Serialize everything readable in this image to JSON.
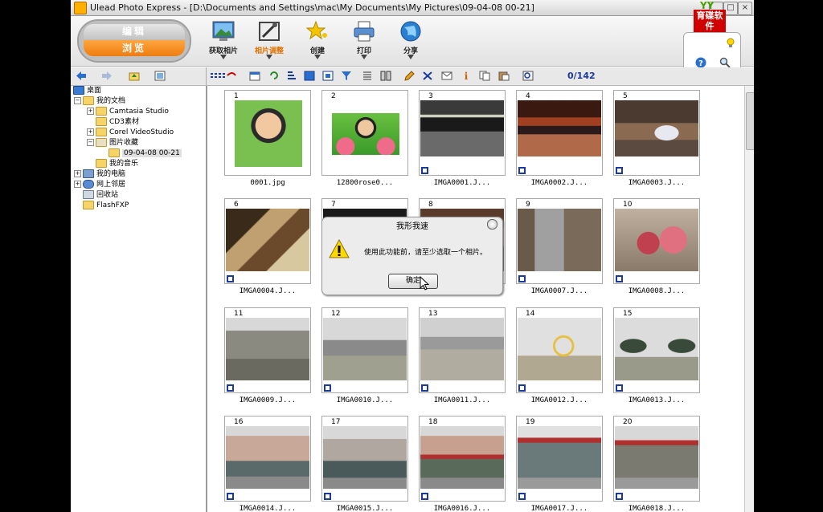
{
  "window": {
    "title": "Ulead Photo Express - [D:\\Documents and Settings\\mac\\My Documents\\My Pictures\\09-04-08 00-21]",
    "controls": {
      "minimize": "_",
      "maximize": "□",
      "close": "×"
    }
  },
  "logo": {
    "brand": "YY",
    "text": "育碟软件"
  },
  "modes": {
    "edit": "编辑",
    "browse": "浏览"
  },
  "toolbar": [
    {
      "label": "获取相片",
      "icon": "get-photo-icon"
    },
    {
      "label": "相片调整",
      "icon": "photo-adjust-icon"
    },
    {
      "label": "创建",
      "icon": "create-star-icon"
    },
    {
      "label": "打印",
      "icon": "printer-icon"
    },
    {
      "label": "分享",
      "icon": "share-globe-icon"
    }
  ],
  "browser": {
    "counter": "0/142"
  },
  "tree": [
    {
      "label": "桌面",
      "icon": "desktop-icon"
    },
    {
      "label": "我的文档",
      "icon": "documents-icon"
    },
    {
      "label": "Camtasia Studio",
      "icon": "folder-icon"
    },
    {
      "label": "CD3素材",
      "icon": "folder-icon"
    },
    {
      "label": "Corel VideoStudio",
      "icon": "folder-icon"
    },
    {
      "label": "图片收藏",
      "icon": "pictures-folder-icon"
    },
    {
      "label": "09-04-08 00-21",
      "icon": "folder-icon"
    },
    {
      "label": "我的音乐",
      "icon": "music-folder-icon"
    },
    {
      "label": "我的电脑",
      "icon": "computer-icon"
    },
    {
      "label": "网上邻居",
      "icon": "network-icon"
    },
    {
      "label": "回收站",
      "icon": "recycle-bin-icon"
    },
    {
      "label": "FlashFXP",
      "icon": "folder-icon"
    }
  ],
  "photos": [
    {
      "num": "1",
      "name": "0001.jpg"
    },
    {
      "num": "2",
      "name": "12800rose0..."
    },
    {
      "num": "3",
      "name": "IMGA0001.J..."
    },
    {
      "num": "4",
      "name": "IMGA0002.J..."
    },
    {
      "num": "5",
      "name": "IMGA0003.J..."
    },
    {
      "num": "6",
      "name": "IMGA0004.J..."
    },
    {
      "num": "7",
      "name": ""
    },
    {
      "num": "8",
      "name": ""
    },
    {
      "num": "9",
      "name": "IMGA0007.J..."
    },
    {
      "num": "10",
      "name": "IMGA0008.J..."
    },
    {
      "num": "11",
      "name": "IMGA0009.J..."
    },
    {
      "num": "12",
      "name": "IMGA0010.J..."
    },
    {
      "num": "13",
      "name": "IMGA0011.J..."
    },
    {
      "num": "14",
      "name": "IMGA0012.J..."
    },
    {
      "num": "15",
      "name": "IMGA0013.J..."
    },
    {
      "num": "16",
      "name": "IMGA0014.J..."
    },
    {
      "num": "17",
      "name": "IMGA0015.J..."
    },
    {
      "num": "18",
      "name": "IMGA0016.J..."
    },
    {
      "num": "19",
      "name": "IMGA0017.J..."
    },
    {
      "num": "20",
      "name": "IMGA0018.J..."
    }
  ],
  "dialog": {
    "title": "我形我速",
    "message": "使用此功能前，请至少选取一个相片。",
    "ok": "确定"
  }
}
